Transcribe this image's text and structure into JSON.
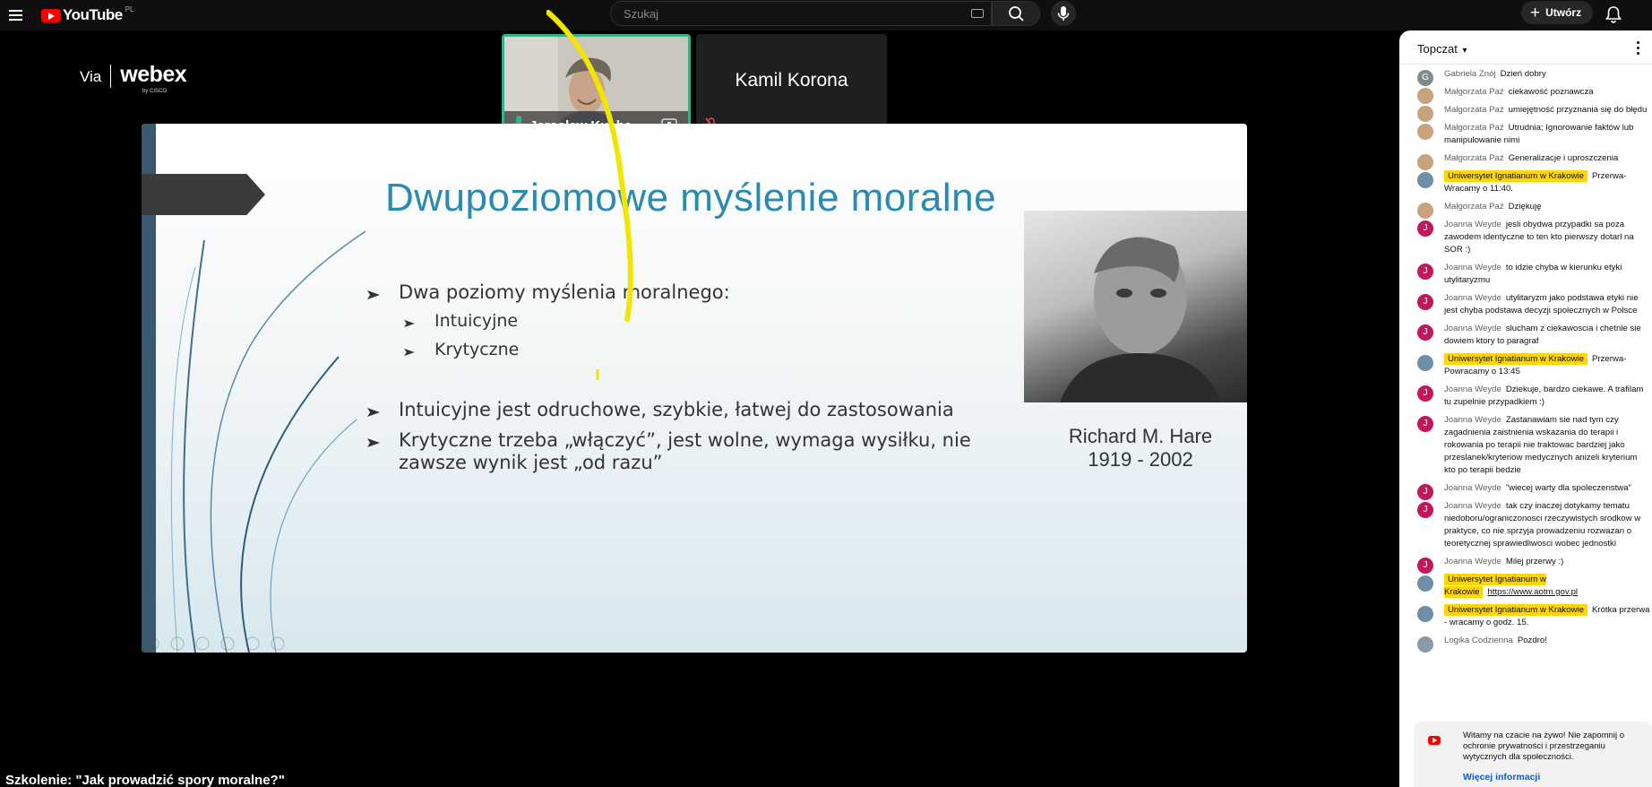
{
  "app": {
    "logo_text": "YouTube",
    "region": "PL"
  },
  "search": {
    "placeholder": "Szukaj"
  },
  "header": {
    "create_label": "Utwórz"
  },
  "video": {
    "title": "Szkolenie: \"Jak prowadzić spory moralne?\"",
    "webex": {
      "via": "Via",
      "brand": "webex",
      "by": "by CISCO"
    },
    "participants": [
      {
        "name": "Jarosław Kucha..."
      },
      {
        "name": "Kamil Korona"
      }
    ],
    "slide": {
      "title": "Dwupoziomowe myślenie moralne",
      "bullet1": "Dwa poziomy myślenia moralnego:",
      "sub1": "Intuicyjne",
      "sub2": "Krytyczne",
      "bullet2": "Intuicyjne jest odruchowe, szybkie, łatwej do zastosowania",
      "bullet3_line1": "Krytyczne trzeba „włączyć”, jest wolne, wymaga wysiłku, nie",
      "bullet3_line2": "zawsze wynik jest „od razu”",
      "caption_name": "Richard M. Hare",
      "caption_years": "1919 - 2002"
    }
  },
  "chat": {
    "mode": "Topczat",
    "messages": [
      {
        "author": "Gabriela Znój",
        "text": "Dzień dobry",
        "avatar_letter": "G",
        "avatar_color": "#7f8c8d"
      },
      {
        "author": "Małgorzata Paź",
        "text": "ciekawość poznawcza",
        "avatar_letter": "",
        "avatar_color": "#c8a27c"
      },
      {
        "author": "Małgorzata Paź",
        "text": "umiejętność przyznania się do błędu",
        "avatar_letter": "",
        "avatar_color": "#c8a27c"
      },
      {
        "author": "Małgorzata Paź",
        "text": "Utrudnia; Ignorowanie faktów lub manipulowanie nimi",
        "avatar_letter": "",
        "avatar_color": "#c8a27c"
      },
      {
        "author": "Małgorzata Paź",
        "text": "Generalizacje i uproszczenia",
        "avatar_letter": "",
        "avatar_color": "#c8a27c"
      },
      {
        "author": "Uniwersytet Ignatianum w Krakowie",
        "text": "Przerwa- Wracamy o 11:40.",
        "avatar_letter": "",
        "avatar_color": "#6f8ea8",
        "highlight": true
      },
      {
        "author": "Małgorzata Paź",
        "text": "Dziękuję",
        "avatar_letter": "",
        "avatar_color": "#c8a27c"
      },
      {
        "author": "Joanna Weyde",
        "text": "jesli obydwa przypadki sa poza zawodem identyczne to ten kto pierwszy dotarl na SOR :)",
        "avatar_letter": "J",
        "avatar_color": "#c2185b"
      },
      {
        "author": "Joanna Weyde",
        "text": "to idzie chyba w kierunku etyki utylitaryzmu",
        "avatar_letter": "J",
        "avatar_color": "#c2185b"
      },
      {
        "author": "Joanna Weyde",
        "text": "utylitaryzm jako podstawa etyki nie jest chyba podstawa decyzji spolecznych w Polsce",
        "avatar_letter": "J",
        "avatar_color": "#c2185b"
      },
      {
        "author": "Joanna Weyde",
        "text": "slucham z ciekawoscia i chetnie sie dowiem ktory to paragraf",
        "avatar_letter": "J",
        "avatar_color": "#c2185b"
      },
      {
        "author": "Uniwersytet Ignatianum w Krakowie",
        "text": "Przerwa- Powracamy o 13:45",
        "avatar_letter": "",
        "avatar_color": "#6f8ea8",
        "highlight": true
      },
      {
        "author": "Joanna Weyde",
        "text": "Dziekuje, bardzo ciekawe. A trafilam tu zupelnie przypadkiem :)",
        "avatar_letter": "J",
        "avatar_color": "#c2185b"
      },
      {
        "author": "Joanna Weyde",
        "text": "Zastanawiam sie nad tym czy zagadnienia zaistnienia wskazania do terapii i rokowania po terapii nie traktowac bardziej jako przeslanek/kryteriow medycznych anizeli kryterium kto po terapii bedzie",
        "avatar_letter": "J",
        "avatar_color": "#c2185b"
      },
      {
        "author": "Joanna Weyde",
        "text": "\"wiecej warty dla spoleczenstwa\"",
        "avatar_letter": "J",
        "avatar_color": "#c2185b"
      },
      {
        "author": "Joanna Weyde",
        "text": "tak czy inaczej dotykamy tematu niedoboru/ograniczonosci rzeczywistych srodkow w praktyce, co nie sprzyja prowadzeniu rozwazan o teoretycznej sprawiedliwosci wobec jednostki",
        "avatar_letter": "J",
        "avatar_color": "#c2185b"
      },
      {
        "author": "Joanna Weyde",
        "text": "Milej przerwy :)",
        "avatar_letter": "J",
        "avatar_color": "#c2185b"
      },
      {
        "author": "Uniwersytet Ignatianum w Krakowie",
        "text": "https://www.aotm.gov.pl",
        "avatar_letter": "",
        "avatar_color": "#6f8ea8",
        "highlight": true,
        "is_link": true
      },
      {
        "author": "Uniwersytet Ignatianum w Krakowie",
        "text": "Krótka przerwa - wracamy o godz. 15.",
        "avatar_letter": "",
        "avatar_color": "#6f8ea8",
        "highlight": true
      },
      {
        "author": "Logika Codzienna",
        "text": "Pozdro!",
        "avatar_letter": "",
        "avatar_color": "#8a9aa8"
      }
    ],
    "notice": {
      "text": "Witamy na czacie na żywo! Nie zapomnij o ochronie prywatności i przestrzeganiu wytycznych dla społeczności.",
      "link": "Więcej informacji"
    }
  }
}
